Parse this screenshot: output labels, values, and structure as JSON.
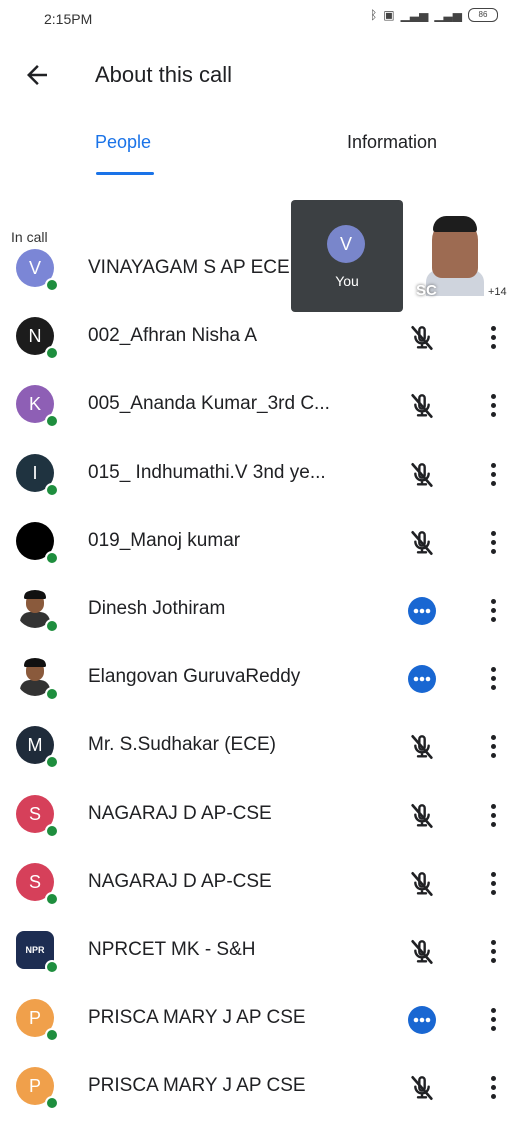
{
  "status_bar": {
    "time": "2:15PM",
    "battery": "86",
    "icons": [
      "bluetooth-icon",
      "volte-icon",
      "signal-icon",
      "signal-icon",
      "battery-icon"
    ]
  },
  "header": {
    "title": "About this call",
    "back_icon": "arrow-back-icon"
  },
  "tabs": [
    {
      "label": "People",
      "active": true
    },
    {
      "label": "Information",
      "active": false
    }
  ],
  "section": {
    "in_call_label": "In call"
  },
  "self_preview": {
    "initial": "V",
    "label": "You"
  },
  "video_preview": {
    "overlay_text": "SC",
    "more_count": "+14"
  },
  "colors": {
    "accent": "#1a73e8",
    "online": "#1e8e3e",
    "active_speaker": "#1967d2"
  },
  "participants": [
    {
      "name": "VINAYAGAM S AP ECE",
      "initial": "V",
      "avatar_color": "#7b86d6",
      "avatar_type": "initial",
      "status": "none"
    },
    {
      "name": "002_Afhran Nisha A",
      "initial": "N",
      "avatar_color": "#1c1c1c",
      "avatar_type": "initial",
      "status": "muted"
    },
    {
      "name": "005_Ananda Kumar_3rd C...",
      "initial": "K",
      "avatar_color": "#8e5fb5",
      "avatar_type": "initial",
      "status": "muted"
    },
    {
      "name": "015_ Indhumathi.V 3nd ye...",
      "initial": "I",
      "avatar_color": "#1f3340",
      "avatar_type": "initial",
      "status": "muted"
    },
    {
      "name": "019_Manoj kumar",
      "initial": "",
      "avatar_color": "#000000",
      "avatar_type": "initial",
      "status": "muted"
    },
    {
      "name": "Dinesh Jothiram",
      "initial": "",
      "avatar_color": "#ffffff",
      "avatar_type": "photo",
      "status": "speaking"
    },
    {
      "name": "Elangovan GuruvaReddy",
      "initial": "",
      "avatar_color": "#ffffff",
      "avatar_type": "photo",
      "status": "speaking"
    },
    {
      "name": "Mr. S.Sudhakar (ECE)",
      "initial": "M",
      "avatar_color": "#1f2b3a",
      "avatar_type": "initial",
      "status": "muted"
    },
    {
      "name": "NAGARAJ D AP-CSE",
      "initial": "S",
      "avatar_color": "#d6405a",
      "avatar_type": "initial",
      "status": "muted"
    },
    {
      "name": "NAGARAJ D AP-CSE",
      "initial": "S",
      "avatar_color": "#d6405a",
      "avatar_type": "initial",
      "status": "muted"
    },
    {
      "name": "NPRCET MK - S&H",
      "initial": "NPR",
      "avatar_color": "#1d2d52",
      "avatar_type": "logo",
      "status": "muted"
    },
    {
      "name": "PRISCA MARY J AP CSE",
      "initial": "P",
      "avatar_color": "#f0a04b",
      "avatar_type": "initial",
      "status": "speaking"
    },
    {
      "name": "PRISCA MARY J AP CSE",
      "initial": "P",
      "avatar_color": "#f0a04b",
      "avatar_type": "initial",
      "status": "muted"
    }
  ]
}
